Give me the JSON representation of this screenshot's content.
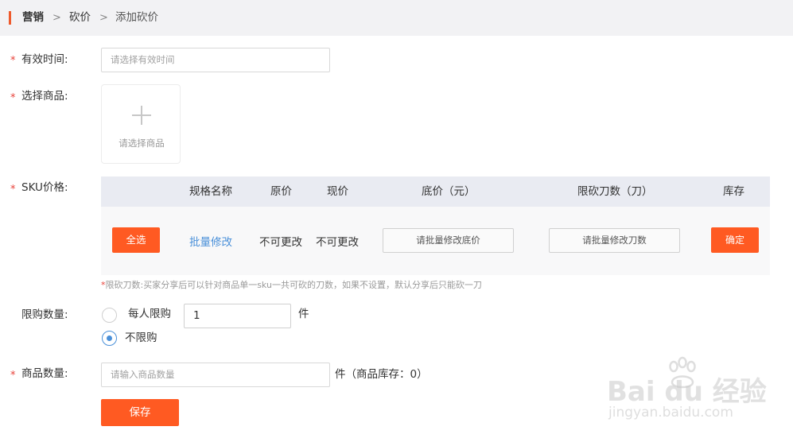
{
  "breadcrumb": {
    "items": [
      "营销",
      "砍价",
      "添加砍价"
    ],
    "separator": ">"
  },
  "form": {
    "required_mark": "*",
    "valid_time": {
      "label": "有效时间:",
      "placeholder": "请选择有效时间"
    },
    "product": {
      "label": "选择商品:",
      "picker_text": "请选择商品"
    },
    "sku": {
      "label": "SKU价格:",
      "headers": [
        "规格名称",
        "原价",
        "现价",
        "底价（元）",
        "限砍刀数（刀）",
        "库存"
      ],
      "select_all_button": "全选",
      "batch_link": "批量修改",
      "original_price": "不可更改",
      "current_price": "不可更改",
      "batch_floor_price_button": "请批量修改底价",
      "batch_cut_count_button": "请批量修改刀数",
      "confirm_button": "确定",
      "note_star": "*",
      "note": "限砍刀数:买家分享后可以针对商品单一sku一共可砍的刀数，如果不设置，默认分享后只能砍一刀"
    },
    "limit": {
      "label": "限购数量:",
      "option_per_person": "每人限购",
      "per_person_value": "1",
      "unit": "件",
      "option_unlimited": "不限购",
      "selected": "不限购"
    },
    "quantity": {
      "label": "商品数量:",
      "placeholder": "请输入商品数量",
      "suffix": "件（商品库存：0）"
    },
    "save_button": "保存"
  },
  "watermark": {
    "brand": "Bai du 经验",
    "url": "jingyan.baidu.com"
  },
  "colors": {
    "accent": "#ee5a2c",
    "button": "#ff5a22",
    "link": "#4a90d9",
    "required": "#e8423a",
    "header_bg": "#f2f2f4",
    "table_head_bg": "#e9ebf2"
  }
}
